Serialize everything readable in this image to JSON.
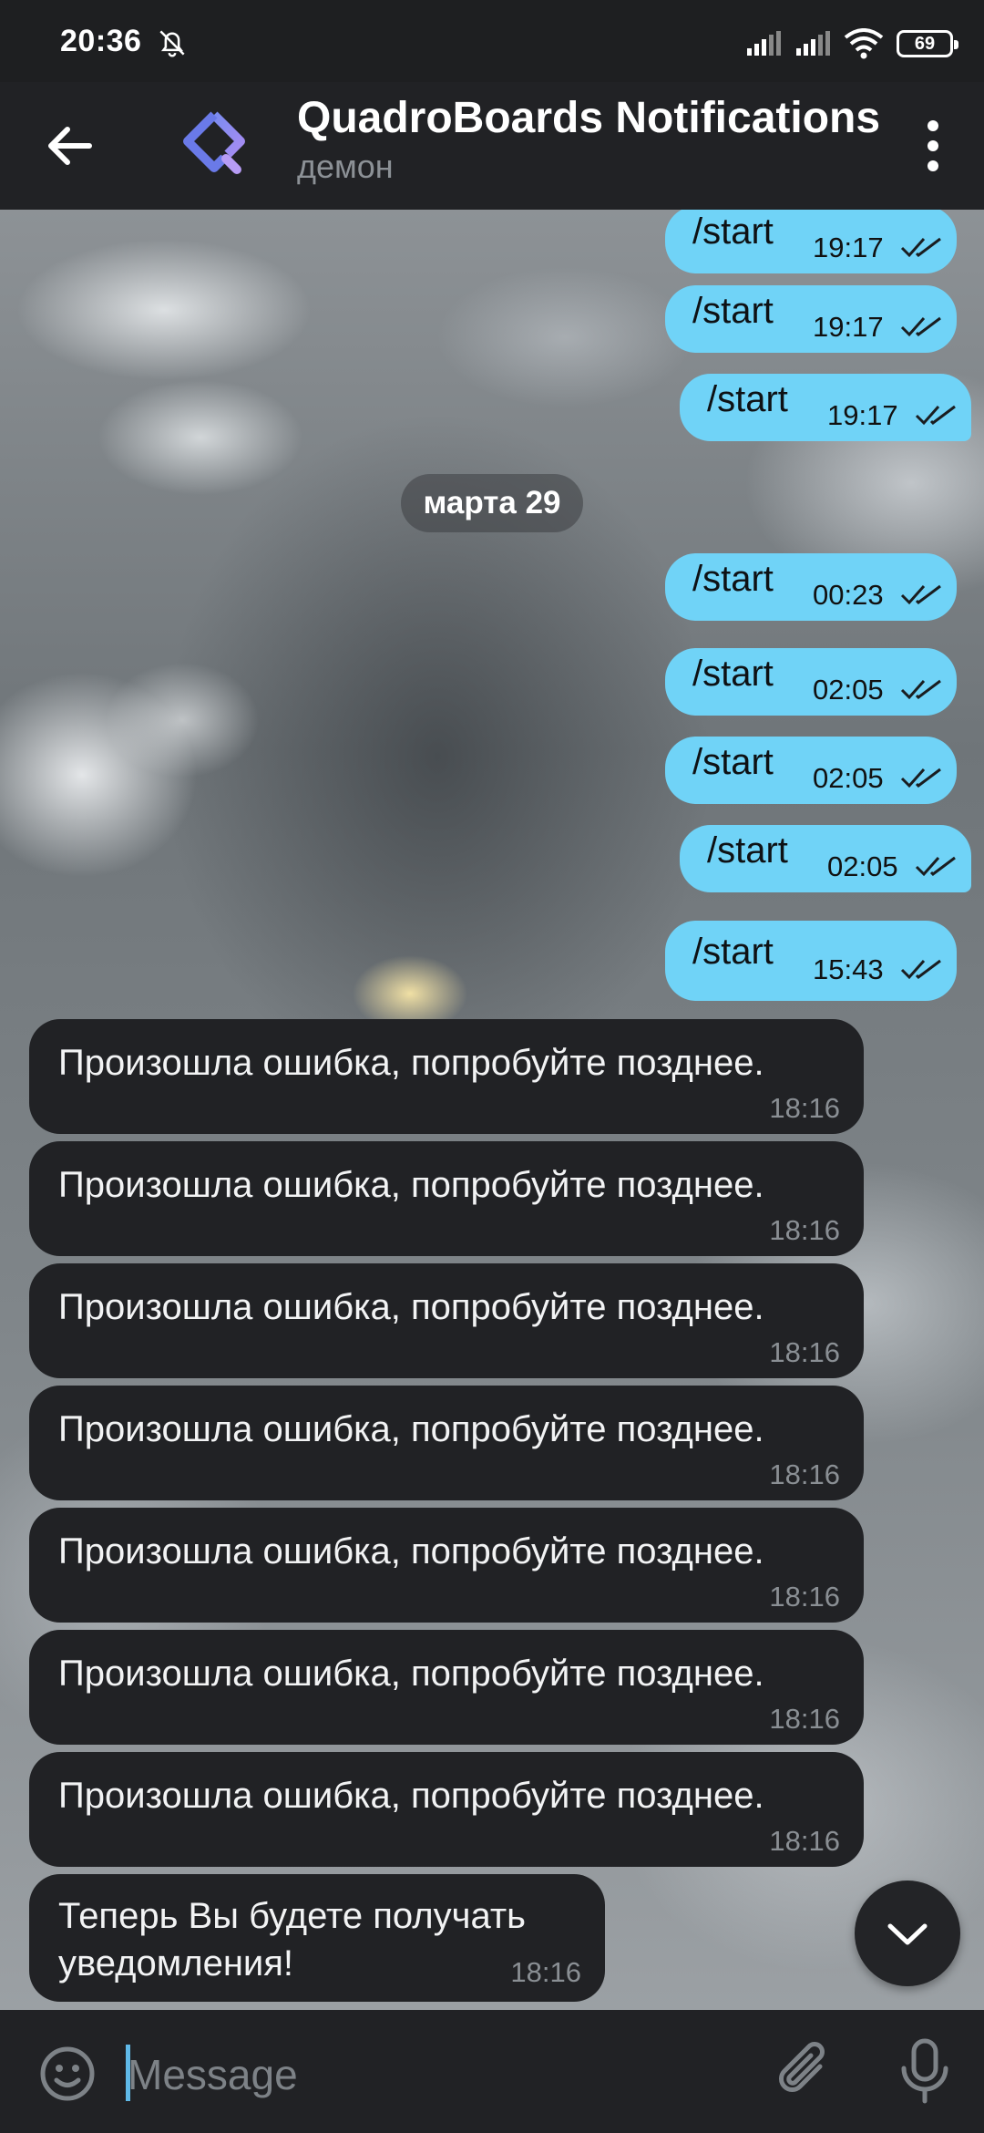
{
  "status_bar": {
    "time": "20:36",
    "battery": "69"
  },
  "header": {
    "title": "QuadroBoards Notifications",
    "subtitle": "демон"
  },
  "messages_out_before": [
    {
      "text": "/start",
      "time": "19:17"
    },
    {
      "text": "/start",
      "time": "19:17"
    },
    {
      "text": "/start",
      "time": "19:17"
    }
  ],
  "date_separator": "марта 29",
  "messages_out_after": [
    {
      "text": "/start",
      "time": "00:23"
    },
    {
      "text": "/start",
      "time": "02:05"
    },
    {
      "text": "/start",
      "time": "02:05"
    },
    {
      "text": "/start",
      "time": "02:05"
    },
    {
      "text": "/start",
      "time": "15:43"
    }
  ],
  "messages_in": [
    {
      "text": "Произошла ошибка, попробуйте позднее.",
      "time": "18:16"
    },
    {
      "text": "Произошла ошибка, попробуйте позднее.",
      "time": "18:16"
    },
    {
      "text": "Произошла ошибка, попробуйте позднее.",
      "time": "18:16"
    },
    {
      "text": "Произошла ошибка, попробуйте позднее.",
      "time": "18:16"
    },
    {
      "text": "Произошла ошибка, попробуйте позднее.",
      "time": "18:16"
    },
    {
      "text": "Произошла ошибка, попробуйте позднее.",
      "time": "18:16"
    },
    {
      "text": "Произошла ошибка, попробуйте позднее.",
      "time": "18:16"
    }
  ],
  "last_message": {
    "line1": "Теперь Вы будете получать",
    "line2": "уведомления!",
    "time": "18:16"
  },
  "input": {
    "placeholder": "Message"
  },
  "colors": {
    "outgoing_bubble": "#70d3f7",
    "incoming_bubble": "#212225",
    "header": "#212225",
    "accent": "#5fb9e8"
  },
  "icons": [
    "back-arrow-icon",
    "bot-avatar-logo",
    "more-vertical-icon",
    "bell-muted-icon",
    "signal-icon",
    "wifi-icon",
    "battery-icon",
    "double-check-icon",
    "chevron-down-icon",
    "emoji-icon",
    "paperclip-icon",
    "microphone-icon"
  ]
}
